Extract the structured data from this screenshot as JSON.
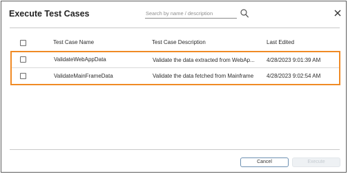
{
  "dialog": {
    "title": "Execute Test Cases",
    "search": {
      "placeholder": "Search by name / description",
      "value": ""
    },
    "search_icon": "search-icon",
    "close_icon": "close-icon"
  },
  "table": {
    "columns": [
      "Test Case Name",
      "Test Case Description",
      "Last Edited"
    ],
    "rows": [
      {
        "checked": false,
        "name": "ValidateWebAppData",
        "description": "Validate the data extracted from WebAp...",
        "last_edited": "4/28/2023 9:01:39 AM"
      },
      {
        "checked": false,
        "name": "ValidateMainFrameData",
        "description": "Validate the data fetched from Mainframe",
        "last_edited": "4/28/2023 9:02:54 AM"
      }
    ]
  },
  "footer": {
    "cancel_label": "Cancel",
    "execute_label": "Execute"
  },
  "colors": {
    "highlight": "#f08a24",
    "cancel_border": "#6c8fb1",
    "execute_disabled_bg": "#eef1f4"
  }
}
